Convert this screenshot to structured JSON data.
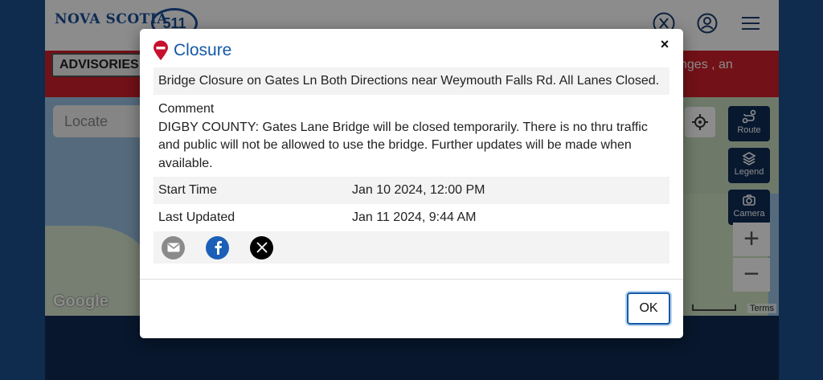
{
  "brand": {
    "logo_text": "NOVA SCOTIA",
    "logo_511": "511"
  },
  "header": {
    "icons": [
      "x-icon",
      "user-icon",
      "menu-icon"
    ]
  },
  "advisories": {
    "button_label": "ADVISORIES",
    "ticker_text": "nges , an"
  },
  "map": {
    "locate_placeholder": "Locate",
    "route_label": "Route",
    "legend_label": "Legend",
    "camera_label": "Camera",
    "zoom_in": "+",
    "zoom_out": "−",
    "google_label": "Google",
    "terms_label": "Terms"
  },
  "modal": {
    "title": "Closure",
    "close_symbol": "×",
    "summary": "Bridge Closure on Gates Ln Both Directions near Weymouth Falls Rd. All Lanes Closed.",
    "comment_label": "Comment",
    "comment_text": "DIGBY COUNTY: Gates Lane Bridge will be closed temporarily. There is no thru traffic and public will not be allowed to use the bridge. Further updates will be made when available.",
    "rows": [
      {
        "label": "Start Time",
        "value": "Jan 10 2024, 12:00 PM"
      },
      {
        "label": "Last Updated",
        "value": "Jan 11 2024, 9:44 AM"
      }
    ],
    "share_icons": [
      "email-icon",
      "facebook-icon",
      "x-icon"
    ],
    "ok_label": "OK"
  },
  "colors": {
    "accent": "#1559a8",
    "red_bar": "#d0202a",
    "page_bg": "#1c4f8f",
    "side_button": "#0d2d57"
  }
}
